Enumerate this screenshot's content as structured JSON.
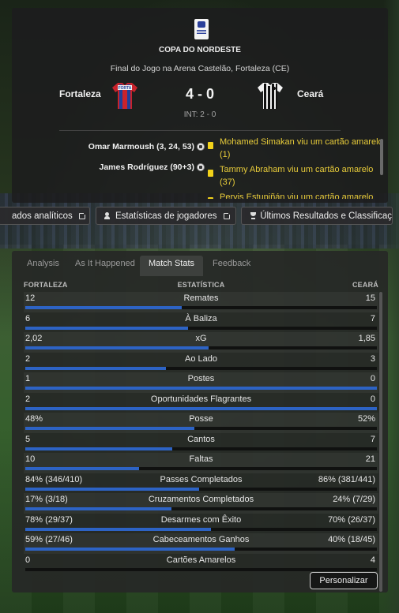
{
  "match": {
    "competition": "COPA DO NORDESTE",
    "venue": "Final do Jogo na Arena Castelão, Fortaleza (CE)",
    "home_team": "Fortaleza",
    "away_team": "Ceará",
    "score": "4 - 0",
    "halftime": "INT: 2 - 0",
    "scorers": [
      "Omar Marmoush (3, 24, 53)",
      "James Rodríguez (90+3)"
    ],
    "events": [
      "Mohamed Simakan viu um cartão amarelo (1)",
      "Tammy Abraham viu um cartão amarelo (37)",
      "Pervis Estupiñán viu um cartão amarelo"
    ],
    "home_kit_text": "FORTA"
  },
  "links": {
    "analytics": "ados analíticos",
    "player_stats": "Estatísticas de jogadores",
    "results": "Últimos Resultados e Classificaç"
  },
  "tabs": {
    "analysis": "Analysis",
    "as_it_happened": "As It Happened",
    "match_stats": "Match Stats",
    "feedback": "Feedback"
  },
  "stats": {
    "header_home": "FORTALEZA",
    "header_mid": "ESTATÍSTICA",
    "header_away": "CEARÁ",
    "rows": [
      {
        "home": "12",
        "label": "Remates",
        "away": "15",
        "home_share": 0.444
      },
      {
        "home": "6",
        "label": "À Baliza",
        "away": "7",
        "home_share": 0.462
      },
      {
        "home": "2,02",
        "label": "xG",
        "away": "1,85",
        "home_share": 0.522
      },
      {
        "home": "2",
        "label": "Ao Lado",
        "away": "3",
        "home_share": 0.4
      },
      {
        "home": "1",
        "label": "Postes",
        "away": "0",
        "home_share": 1.0
      },
      {
        "home": "2",
        "label": "Oportunidades Flagrantes",
        "away": "0",
        "home_share": 1.0
      },
      {
        "home": "48%",
        "label": "Posse",
        "away": "52%",
        "home_share": 0.48
      },
      {
        "home": "5",
        "label": "Cantos",
        "away": "7",
        "home_share": 0.417
      },
      {
        "home": "10",
        "label": "Faltas",
        "away": "21",
        "home_share": 0.323
      },
      {
        "home": "84% (346/410)",
        "label": "Passes Completados",
        "away": "86% (381/441)",
        "home_share": 0.494
      },
      {
        "home": "17% (3/18)",
        "label": "Cruzamentos Completados",
        "away": "24% (7/29)",
        "home_share": 0.415
      },
      {
        "home": "78% (29/37)",
        "label": "Desarmes com Êxito",
        "away": "70% (26/37)",
        "home_share": 0.527
      },
      {
        "home": "59% (27/46)",
        "label": "Cabeceamentos Ganhos",
        "away": "40% (18/45)",
        "home_share": 0.596
      },
      {
        "home": "0",
        "label": "Cartões Amarelos",
        "away": "4",
        "home_share": 0.0
      }
    ]
  },
  "customize_label": "Personalizar",
  "colors": {
    "bar": "#2d63c4",
    "card": "#f2d21a",
    "event_text": "#e8cc3a"
  }
}
